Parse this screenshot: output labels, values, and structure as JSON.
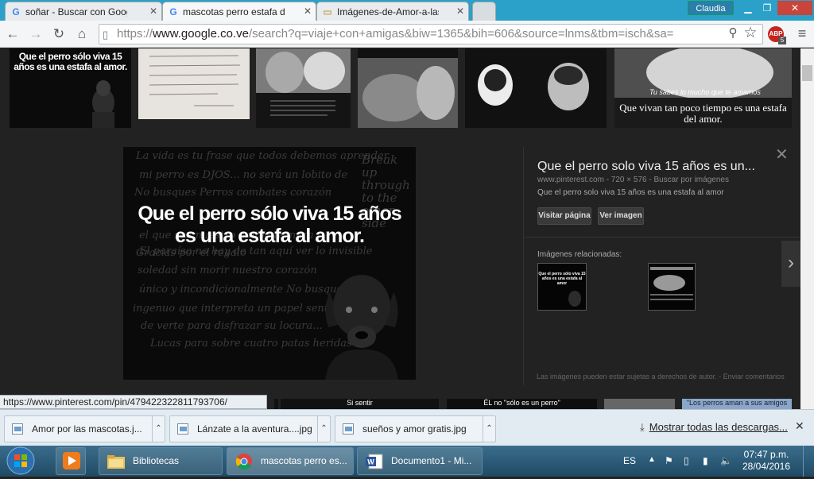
{
  "browser": {
    "tabs": [
      {
        "title": "soñar - Buscar con Google",
        "active": false
      },
      {
        "title": "mascotas perro estafa de",
        "active": true
      },
      {
        "title": "Imágenes-de-Amor-a-las-",
        "active": false
      }
    ],
    "user": "Claudia",
    "url": {
      "scheme": "https://",
      "domain": "www.google.co.ve",
      "rest": "/search?q=viaje+con+amigas&biw=1365&bih=606&source=lnms&tbm=isch&sa="
    },
    "abp_badge": "ABP",
    "abp_count": "5"
  },
  "strip": {
    "item1_text": "Que el perro sólo viva 15 años es una estafa al amor.",
    "item5_text1": "Tu sabes lo mucho que te amamos",
    "item5_text2": "Que vivan tan poco tiempo es una estafa del amor."
  },
  "preview": {
    "headline_1": "Que el perro sólo viva 15 años",
    "headline_2": "es una estafa al amor.",
    "bg_lines": [
      "La vida es tu frase que todos debemos aprender",
      "mi perro es DJOS... no será un lobito de",
      "No busques   Perros combates   corazón",
      "el que sea nuestro amigo   ternura",
      "Gracias por el regalo",
      "El paraíso no hay de tan aquí   ver lo invisible",
      "soledad sin morir   nuestro corazón",
      "único y incondicionalmente   No busques",
      "ingenuo que interpreta un papel   sentido",
      "de verte para disfrazar su locura...",
      "Lucas para sobre cuatro patas heridas"
    ],
    "corner_text": "Break up through to the other side"
  },
  "detail": {
    "title": "Que el perro solo viva 15 años es un...",
    "source": "www.pinterest.com - 720 × 576 - Buscar por imágenes",
    "description": "Que el perro solo viva 15 años es una estafa al amor",
    "visit_label": "Visitar página",
    "view_label": "Ver imagen",
    "related_label": "Imágenes relacionadas:",
    "related_thumb_text": "Que el perro sólo viva 15 años es una estafa al amor",
    "copyright": "Las imágenes pueden estar sujetas a derechos de autor.",
    "feedback": "Enviar comentarios"
  },
  "lower_strip": {
    "t1": "Si sentir",
    "t2": "ÉL no \"sólo es un perro\"",
    "t3": "\"Los perros aman a sus amigos"
  },
  "status_url": "https://www.pinterest.com/pin/479422322811793706/",
  "downloads": {
    "items": [
      "Amor por las mascotas.j...",
      "Lánzate a la aventura....jpg",
      "sueños y amor gratis.jpg"
    ],
    "show_all": "Mostrar todas las descargas..."
  },
  "taskbar": {
    "buttons": [
      "Bibliotecas",
      "mascotas perro es...",
      "Documento1 - Mi..."
    ],
    "lang": "ES",
    "time": "07:47 p.m.",
    "date": "28/04/2016"
  },
  "colors": {
    "titlebar": "#2ba0c8",
    "panel": "#222222",
    "downloads_bar": "#e3ebf2"
  }
}
